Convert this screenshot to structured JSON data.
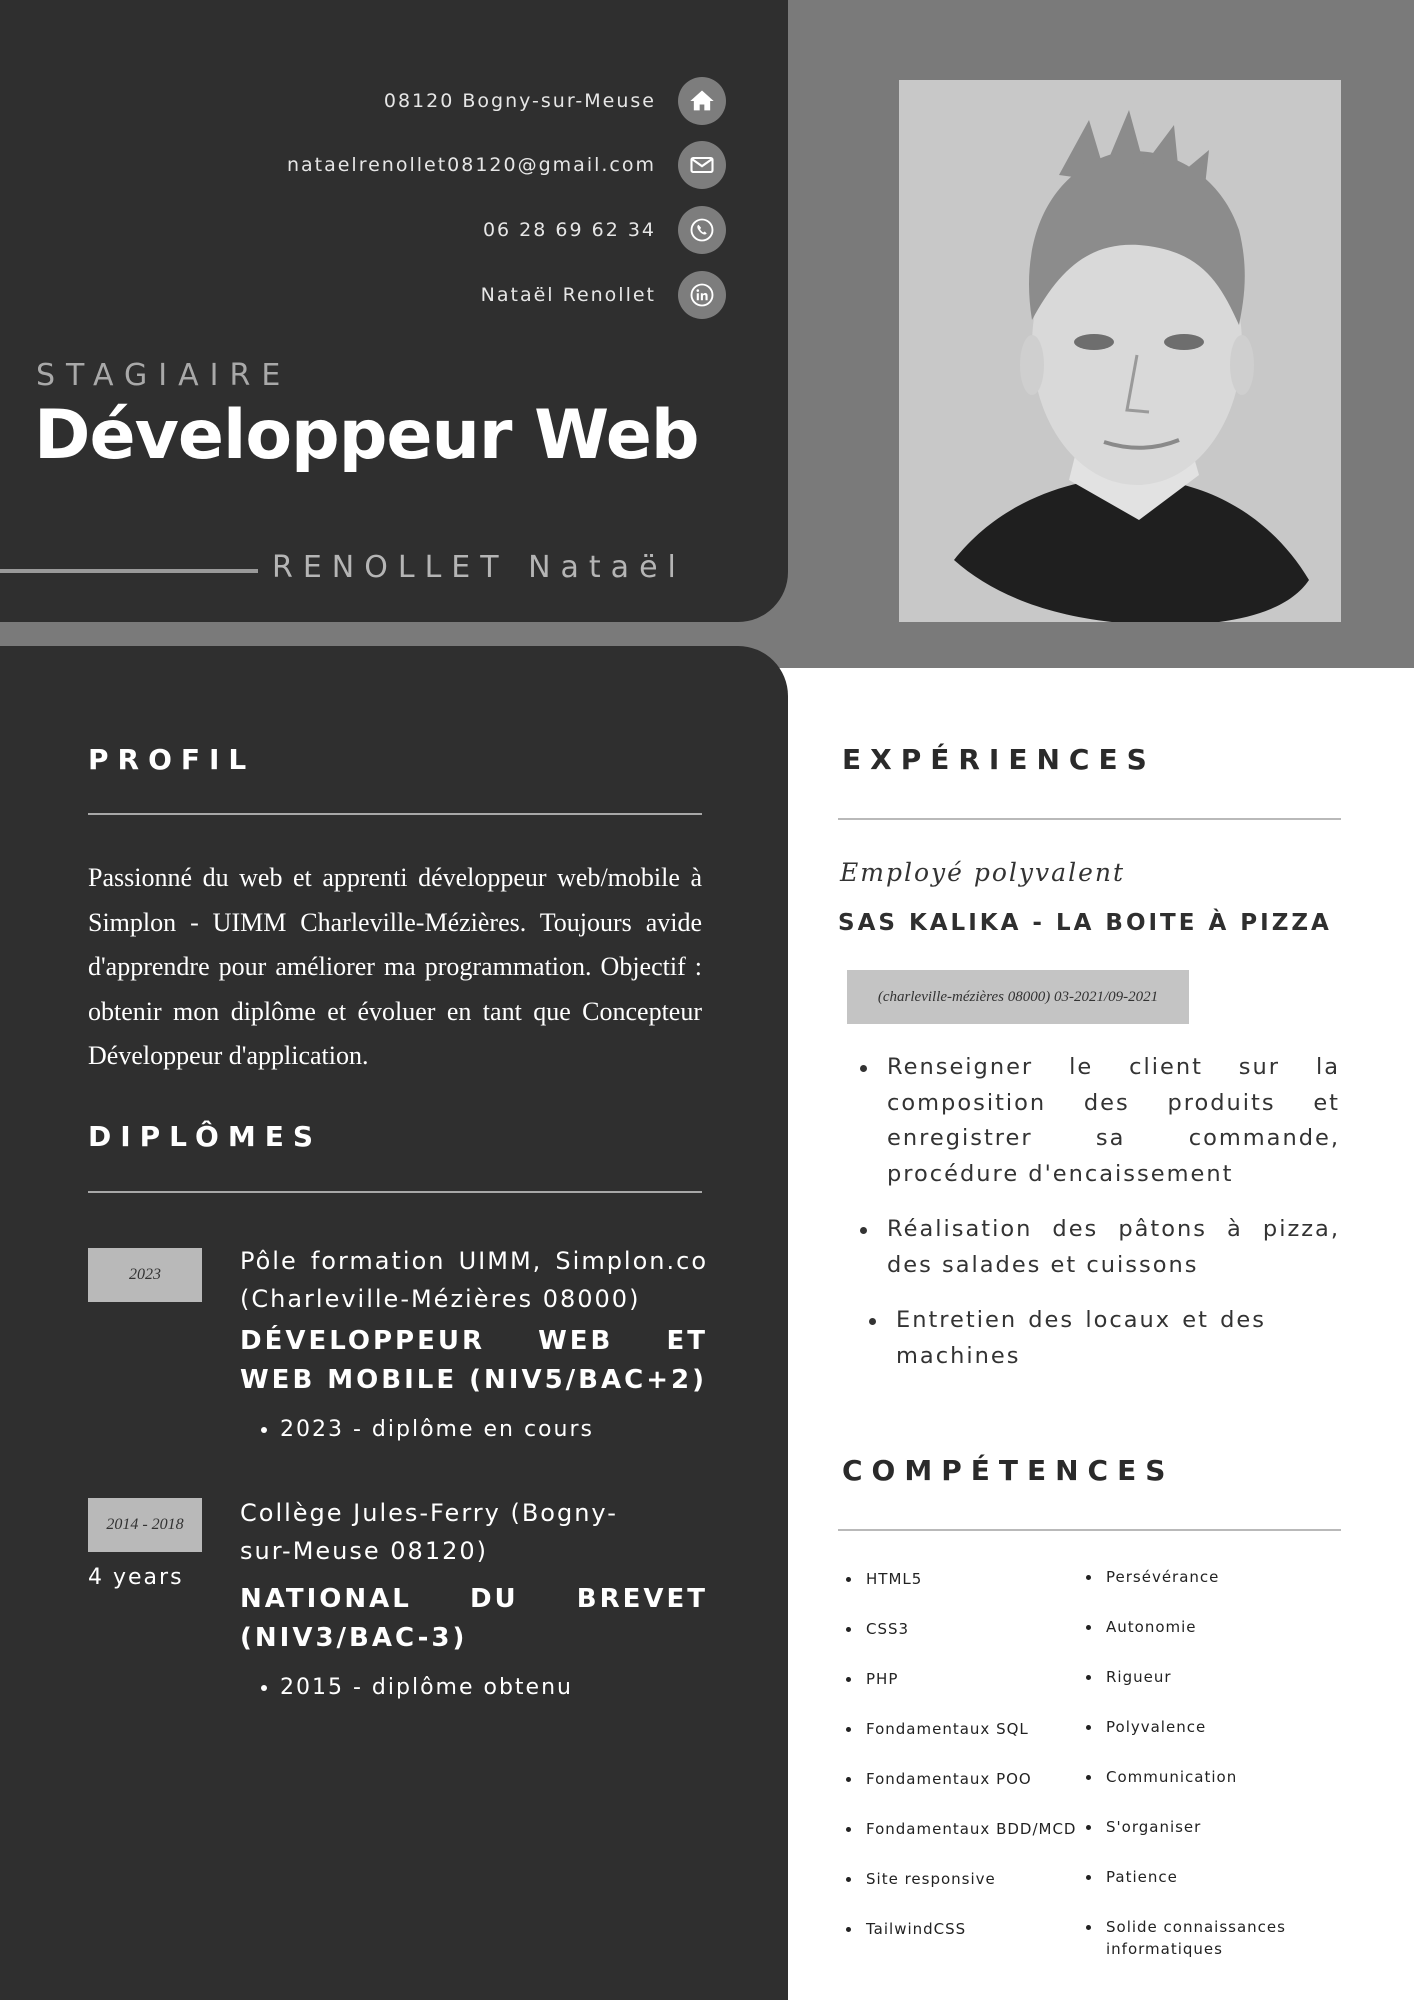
{
  "contacts": {
    "address": "08120 Bogny-sur-Meuse",
    "email": "nataelrenollet08120@gmail.com",
    "phone": "06 28 69 62 34",
    "linkedin": "Nataël Renollet"
  },
  "header": {
    "role": "STAGIAIRE",
    "title": "Développeur Web",
    "name": "RENOLLET Nataël"
  },
  "profile": {
    "heading": "PROFIL",
    "text": "Passionné du web et apprenti développeur web/mobile à Simplon - UIMM Charleville-Mézières. Toujours avide d'apprendre pour améliorer ma programmation. Objectif : obtenir mon diplôme et évoluer en tant que Concepteur Développeur d'application."
  },
  "diplomas": {
    "heading": "DIPLÔMES",
    "items": [
      {
        "date": "2023",
        "duration": "",
        "school": "Pôle formation UIMM, Simplon.co (Charleville-Mézières 08000)",
        "degree": "DÉVELOPPEUR WEB ET WEB MOBILE (NIV5/BAC+2)",
        "detail": "2023 - diplôme en cours"
      },
      {
        "date": "2014 - 2018",
        "duration": "4 years",
        "school": "Collège Jules-Ferry (Bogny-sur-Meuse 08120)",
        "degree": "NATIONAL DU BREVET (NIV3/BAC-3)",
        "detail": "2015 - diplôme obtenu"
      }
    ]
  },
  "experience": {
    "heading": "EXPÉRIENCES",
    "job_title": "Employé polyvalent",
    "company": "SAS KALIKA - LA BOITE À PIZZA",
    "location_dates": "(charleville-mézières 08000) 03-2021/09-2021",
    "tasks": [
      "Renseigner le client sur la composition des produits et enregistrer sa commande, procédure d'encaissement",
      "Réalisation des pâtons à pizza, des salades et cuissons",
      "Entretien des locaux et des machines"
    ]
  },
  "skills": {
    "heading": "COMPÉTENCES",
    "technical": [
      "HTML5",
      "CSS3",
      "PHP",
      "Fondamentaux SQL",
      "Fondamentaux POO",
      "Fondamentaux BDD/MCD",
      "Site responsive",
      "TailwindCSS"
    ],
    "soft": [
      "Persévérance",
      "Autonomie",
      "Rigueur",
      "Polyvalence",
      "Communication",
      "S'organiser",
      "Patience",
      "Solide connaissances informatiques"
    ]
  },
  "icons": {
    "address": "home-icon",
    "email": "mail-icon",
    "phone": "phone-icon",
    "linkedin": "linkedin-icon"
  },
  "colors": {
    "dark_panel": "#2f2f2f",
    "gray_background": "#7a7a7a",
    "badge": "#b9b9b9"
  }
}
